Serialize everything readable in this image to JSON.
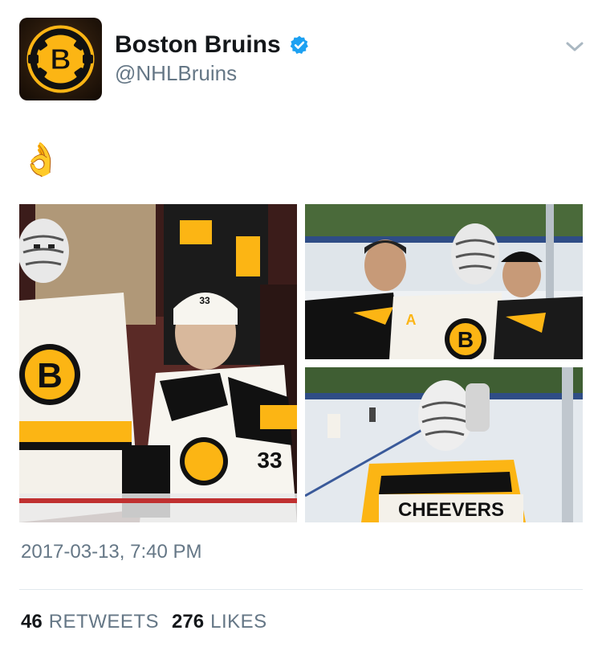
{
  "author": {
    "display_name": "Boston Bruins",
    "handle": "@NHLBruins",
    "verified": true,
    "avatar_icon": "bruins-logo-icon"
  },
  "tweet": {
    "text": "👌",
    "timestamp": "2017-03-13, 7:40 PM"
  },
  "media": {
    "photo_2_bg_text": "A",
    "photo_3_nameplate": "CHEEVERS",
    "jersey_number_helmet": "33",
    "jersey_number_sleeve": "33",
    "logo_letter": "B"
  },
  "stats": {
    "retweets_count": "46",
    "retweets_label": "RETWEETS",
    "likes_count": "276",
    "likes_label": "LIKES"
  },
  "colors": {
    "bruins_gold": "#fcb514",
    "bruins_black": "#111111",
    "verified_blue": "#1da1f2",
    "secondary_text": "#657786"
  }
}
